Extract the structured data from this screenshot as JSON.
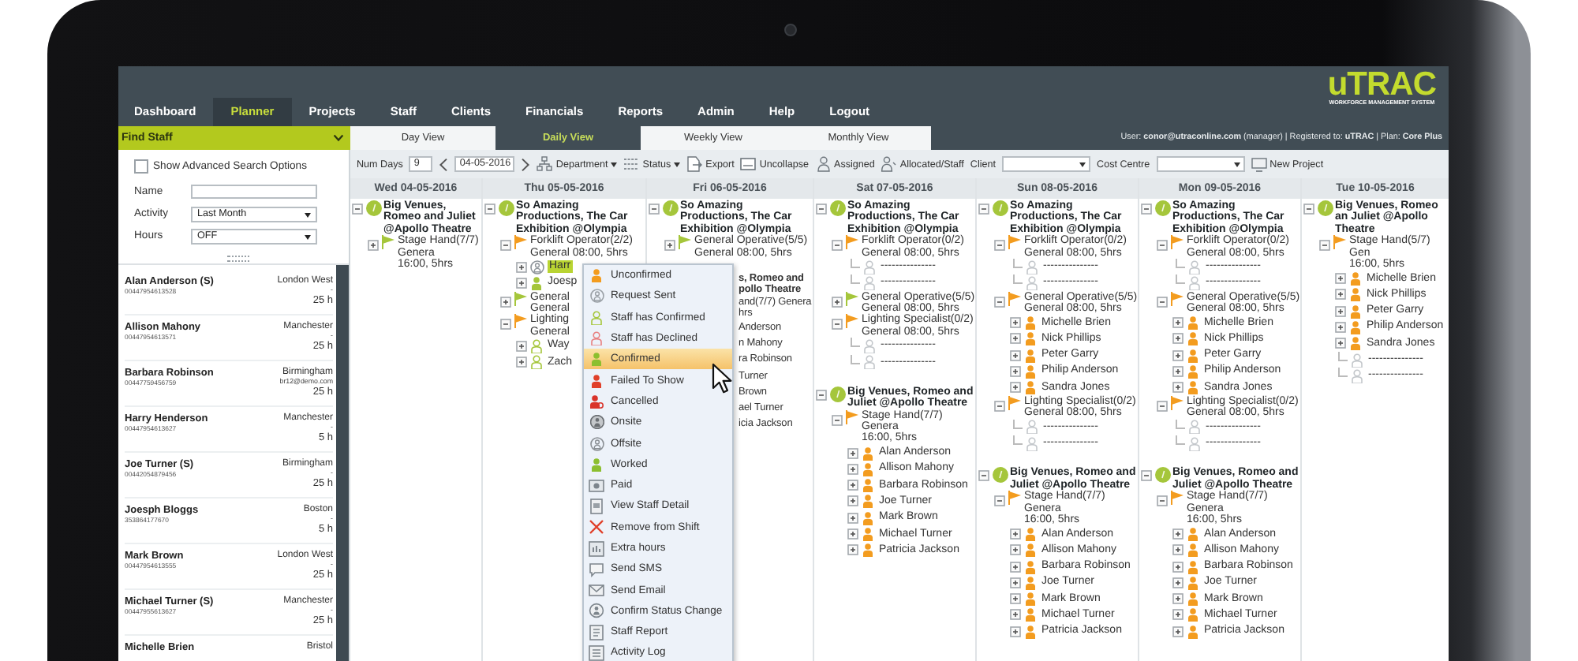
{
  "nav": {
    "logo": "uTRAC",
    "logo_subtitle": "WORKFORCE MANAGEMENT SYSTEM",
    "items": [
      {
        "label": "Dashboard",
        "selected": false
      },
      {
        "label": "Planner",
        "selected": true
      },
      {
        "label": "Projects",
        "selected": false
      },
      {
        "label": "Staff",
        "selected": false
      },
      {
        "label": "Clients",
        "selected": false
      },
      {
        "label": "Financials",
        "selected": false
      },
      {
        "label": "Reports",
        "selected": false
      },
      {
        "label": "Admin",
        "selected": false
      },
      {
        "label": "Help",
        "selected": false
      },
      {
        "label": "Logout",
        "selected": false
      }
    ],
    "user_info": "User: **conor@utraconline.com** (manager) | Registered to: **uTRAC** | Plan: **Core Plus**"
  },
  "find_staff": {
    "title": "Find Staff",
    "advanced": {
      "label": "Show Advanced Search Options",
      "checked": false
    },
    "fields": [
      {
        "label": "Name",
        "kind": "text"
      },
      {
        "label": "Activity",
        "kind": "select",
        "value": "Last Month"
      },
      {
        "label": "Hours",
        "kind": "select",
        "value": "OFF"
      }
    ]
  },
  "staff_list": [
    {
      "name": "Alan Anderson (S)",
      "phone": "00447954613528",
      "location": "London West",
      "email": "-",
      "hours": "25 h"
    },
    {
      "name": "Allison Mahony",
      "phone": "00447954613571",
      "location": "Manchester",
      "email": "-",
      "hours": "25 h"
    },
    {
      "name": "Barbara Robinson",
      "phone": "00447759456759",
      "location": "Birmingham",
      "email": "br12@demo.com",
      "hours": "25 h"
    },
    {
      "name": "Harry Henderson",
      "phone": "00447954613627",
      "location": "Manchester",
      "email": "-",
      "hours": "5 h"
    },
    {
      "name": "Joe Turner (S)",
      "phone": "00442054879456",
      "location": "Birmingham",
      "email": "-",
      "hours": "25 h"
    },
    {
      "name": "Joesph Bloggs",
      "phone": "353864177670",
      "location": "Boston",
      "email": "-",
      "hours": "5 h"
    },
    {
      "name": "Mark Brown",
      "phone": "00447954613555",
      "location": "London West",
      "email": "-",
      "hours": "25 h"
    },
    {
      "name": "Michael Turner (S)",
      "phone": "00447955613627",
      "location": "Manchester",
      "email": "-",
      "hours": "25 h"
    },
    {
      "name": "Michelle Brien",
      "location": "Bristol"
    }
  ],
  "view_tabs": [
    {
      "label": "Day View",
      "selected": false
    },
    {
      "label": "Daily View",
      "selected": true
    },
    {
      "label": "Weekly View",
      "selected": false
    },
    {
      "label": "Monthly View",
      "selected": false
    }
  ],
  "toolbar": {
    "num_days_label": "Num Days",
    "num_days": "9",
    "date": "04-05-2016",
    "actions": [
      {
        "label": "Department",
        "kind": "dropdown"
      },
      {
        "label": "Status",
        "kind": "dropdown"
      },
      {
        "label": "Export",
        "kind": "button"
      },
      {
        "label": "Uncollapse",
        "kind": "button"
      },
      {
        "label": "Assigned",
        "kind": "button"
      },
      {
        "label": "Allocated/Staff",
        "kind": "button"
      }
    ],
    "filters": [
      {
        "label": "Client"
      },
      {
        "label": "Cost Centre"
      }
    ],
    "new_project": "New Project"
  },
  "days": [
    {
      "label": "Wed 04-05-2016",
      "projects": [
        {
          "title": "Big Venues, Romeo and Juliet @Apollo Theatre",
          "expanded": true,
          "roles": [
            {
              "title": "Stage Hand(7/7) Genera",
              "time": "16:00, 5hrs",
              "color": "#a5c63b",
              "expanded": false
            }
          ]
        }
      ]
    },
    {
      "label": "Thu 05-05-2016",
      "projects": [
        {
          "title": "So Amazing Productions, The Car Exhibition @Olympia",
          "expanded": true,
          "roles": [
            {
              "title": "Forklift Operator(2/2)",
              "time": "General 08:00, 5hrs",
              "color": "#f39c1f",
              "expanded": true,
              "staff": [
                {
                  "name": "Harr",
                  "kind": "requested",
                  "selected": true
                },
                {
                  "name": "Joesp",
                  "kind": "confirmed",
                  "selected": false
                }
              ]
            },
            {
              "title": "General",
              "time": "General",
              "color": "#a5c63b",
              "expanded": false
            },
            {
              "title": "Lighting",
              "time": "General",
              "color": "#f39c1f",
              "expanded": true,
              "staff": [
                {
                  "name": "Way",
                  "kind": "accepted",
                  "selected": false
                },
                {
                  "name": "Zach",
                  "kind": "accepted",
                  "selected": false
                }
              ]
            }
          ]
        }
      ]
    },
    {
      "label": "Fri 06-05-2016",
      "projects": [
        {
          "title": "So Amazing Productions, The Car Exhibition @Olympia",
          "expanded": true,
          "roles": [
            {
              "title": "General Operative(5/5)",
              "time": "General 08:00, 5hrs",
              "color": "#a5c63b",
              "expanded": false
            }
          ]
        }
      ],
      "covered": [
        {
          "text": "s, Romeo and",
          "kind": "project"
        },
        {
          "text": "pollo Theatre",
          "kind": "project"
        },
        {
          "text": "and(7/7) Genera",
          "kind": "role"
        },
        {
          "text": "hrs",
          "kind": "role"
        },
        {
          "text": "Anderson",
          "kind": "staff"
        },
        {
          "text": "n Mahony",
          "kind": "staff"
        },
        {
          "text": "ra Robinson",
          "kind": "staff"
        },
        {
          "text": "Turner",
          "kind": "staff"
        },
        {
          "text": "Brown",
          "kind": "staff"
        },
        {
          "text": "ael Turner",
          "kind": "staff"
        },
        {
          "text": "icia Jackson",
          "kind": "staff"
        }
      ]
    },
    {
      "label": "Sat 07-05-2016",
      "projects": [
        {
          "title": "So Amazing Productions, The Car Exhibition @Olympia",
          "expanded": true,
          "roles": [
            {
              "title": "Forklift Operator(0/2)",
              "time": "General 08:00, 5hrs",
              "color": "#f39c1f",
              "expanded": true,
              "staff": [
                {
                  "name": "---------------",
                  "kind": "vacant",
                  "selected": false
                },
                {
                  "name": "---------------",
                  "kind": "vacant",
                  "selected": false
                }
              ]
            },
            {
              "title": "General Operative(5/5)",
              "time": "General 08:00, 5hrs",
              "color": "#a5c63b",
              "expanded": false
            },
            {
              "title": "Lighting Specialist(0/2)",
              "time": "General 08:00, 5hrs",
              "color": "#f39c1f",
              "expanded": true,
              "staff": [
                {
                  "name": "---------------",
                  "kind": "vacant",
                  "selected": false
                },
                {
                  "name": "---------------",
                  "kind": "vacant",
                  "selected": false
                }
              ]
            }
          ]
        },
        {
          "title": "Big Venues, Romeo and Juliet @Apollo Theatre",
          "expanded": true,
          "roles": [
            {
              "title": "Stage Hand(7/7) Genera",
              "time": "16:00, 5hrs",
              "color": "#f39c1f",
              "expanded": true,
              "staff": [
                {
                  "name": "Alan Anderson",
                  "kind": "unconfirmed",
                  "selected": false
                },
                {
                  "name": "Allison Mahony",
                  "kind": "unconfirmed",
                  "selected": false
                },
                {
                  "name": "Barbara Robinson",
                  "kind": "unconfirmed",
                  "selected": false
                },
                {
                  "name": "Joe Turner",
                  "kind": "unconfirmed",
                  "selected": false
                },
                {
                  "name": "Mark Brown",
                  "kind": "unconfirmed",
                  "selected": false
                },
                {
                  "name": "Michael Turner",
                  "kind": "unconfirmed",
                  "selected": false
                },
                {
                  "name": "Patricia Jackson",
                  "kind": "unconfirmed",
                  "selected": false
                }
              ]
            }
          ]
        }
      ]
    },
    {
      "label": "Sun 08-05-2016",
      "projects": [
        {
          "title": "So Amazing Productions, The Car Exhibition @Olympia",
          "expanded": true,
          "roles": [
            {
              "title": "Forklift Operator(0/2)",
              "time": "General 08:00, 5hrs",
              "color": "#f39c1f",
              "expanded": true,
              "staff": [
                {
                  "name": "---------------",
                  "kind": "vacant",
                  "selected": false
                },
                {
                  "name": "---------------",
                  "kind": "vacant",
                  "selected": false
                }
              ]
            },
            {
              "title": "General Operative(5/5)",
              "time": "General 08:00, 5hrs",
              "color": "#f39c1f",
              "expanded": true,
              "staff": [
                {
                  "name": "Michelle Brien",
                  "kind": "unconfirmed",
                  "selected": false
                },
                {
                  "name": "Nick Phillips",
                  "kind": "unconfirmed",
                  "selected": false
                },
                {
                  "name": "Peter Garry",
                  "kind": "unconfirmed",
                  "selected": false
                },
                {
                  "name": "Philip Anderson",
                  "kind": "unconfirmed",
                  "selected": false
                },
                {
                  "name": "Sandra Jones",
                  "kind": "unconfirmed",
                  "selected": false
                }
              ]
            },
            {
              "title": "Lighting Specialist(0/2)",
              "time": "General 08:00, 5hrs",
              "color": "#f39c1f",
              "expanded": true,
              "staff": [
                {
                  "name": "---------------",
                  "kind": "vacant",
                  "selected": false
                },
                {
                  "name": "---------------",
                  "kind": "vacant",
                  "selected": false
                }
              ]
            }
          ]
        },
        {
          "title": "Big Venues, Romeo and Juliet @Apollo Theatre",
          "expanded": true,
          "roles": [
            {
              "title": "Stage Hand(7/7) Genera",
              "time": "16:00, 5hrs",
              "color": "#f39c1f",
              "expanded": true,
              "staff": [
                {
                  "name": "Alan Anderson",
                  "kind": "unconfirmed",
                  "selected": false
                },
                {
                  "name": "Allison Mahony",
                  "kind": "unconfirmed",
                  "selected": false
                },
                {
                  "name": "Barbara Robinson",
                  "kind": "unconfirmed",
                  "selected": false
                },
                {
                  "name": "Joe Turner",
                  "kind": "unconfirmed",
                  "selected": false
                },
                {
                  "name": "Mark Brown",
                  "kind": "unconfirmed",
                  "selected": false
                },
                {
                  "name": "Michael Turner",
                  "kind": "unconfirmed",
                  "selected": false
                },
                {
                  "name": "Patricia Jackson",
                  "kind": "unconfirmed",
                  "selected": false
                }
              ]
            }
          ]
        }
      ]
    },
    {
      "label": "Mon 09-05-2016",
      "projects": [
        {
          "title": "So Amazing Productions, The Car Exhibition @Olympia",
          "expanded": true,
          "roles": [
            {
              "title": "Forklift Operator(0/2)",
              "time": "General 08:00, 5hrs",
              "color": "#f39c1f",
              "expanded": true,
              "staff": [
                {
                  "name": "---------------",
                  "kind": "vacant",
                  "selected": false
                },
                {
                  "name": "---------------",
                  "kind": "vacant",
                  "selected": false
                }
              ]
            },
            {
              "title": "General Operative(5/5)",
              "time": "General 08:00, 5hrs",
              "color": "#f39c1f",
              "expanded": true,
              "staff": [
                {
                  "name": "Michelle Brien",
                  "kind": "unconfirmed",
                  "selected": false
                },
                {
                  "name": "Nick Phillips",
                  "kind": "unconfirmed",
                  "selected": false
                },
                {
                  "name": "Peter Garry",
                  "kind": "unconfirmed",
                  "selected": false
                },
                {
                  "name": "Philip Anderson",
                  "kind": "unconfirmed",
                  "selected": false
                },
                {
                  "name": "Sandra Jones",
                  "kind": "unconfirmed",
                  "selected": false
                }
              ]
            },
            {
              "title": "Lighting Specialist(0/2)",
              "time": "General 08:00, 5hrs",
              "color": "#f39c1f",
              "expanded": true,
              "staff": [
                {
                  "name": "---------------",
                  "kind": "vacant",
                  "selected": false
                },
                {
                  "name": "---------------",
                  "kind": "vacant",
                  "selected": false
                }
              ]
            }
          ]
        },
        {
          "title": "Big Venues, Romeo and Juliet @Apollo Theatre",
          "expanded": true,
          "roles": [
            {
              "title": "Stage Hand(7/7) Genera",
              "time": "16:00, 5hrs",
              "color": "#f39c1f",
              "expanded": true,
              "staff": [
                {
                  "name": "Alan Anderson",
                  "kind": "unconfirmed",
                  "selected": false
                },
                {
                  "name": "Allison Mahony",
                  "kind": "unconfirmed",
                  "selected": false
                },
                {
                  "name": "Barbara Robinson",
                  "kind": "unconfirmed",
                  "selected": false
                },
                {
                  "name": "Joe Turner",
                  "kind": "unconfirmed",
                  "selected": false
                },
                {
                  "name": "Mark Brown",
                  "kind": "unconfirmed",
                  "selected": false
                },
                {
                  "name": "Michael Turner",
                  "kind": "unconfirmed",
                  "selected": false
                },
                {
                  "name": "Patricia Jackson",
                  "kind": "unconfirmed",
                  "selected": false
                }
              ]
            }
          ]
        }
      ]
    },
    {
      "label": "Tue 10-05-2016",
      "projects": [
        {
          "title": "Big Venues, Romeo an Juliet @Apollo Theatre",
          "expanded": true,
          "roles": [
            {
              "title": "Stage Hand(5/7) Gen",
              "time": "16:00, 5hrs",
              "color": "#f39c1f",
              "expanded": true,
              "staff": [
                {
                  "name": "Michelle Brien",
                  "kind": "unconfirmed",
                  "selected": false
                },
                {
                  "name": "Nick Phillips",
                  "kind": "unconfirmed",
                  "selected": false
                },
                {
                  "name": "Peter Garry",
                  "kind": "unconfirmed",
                  "selected": false
                },
                {
                  "name": "Philip Anderson",
                  "kind": "unconfirmed",
                  "selected": false
                },
                {
                  "name": "Sandra Jones",
                  "kind": "unconfirmed",
                  "selected": false
                },
                {
                  "name": "---------------",
                  "kind": "vacant",
                  "selected": false
                },
                {
                  "name": "---------------",
                  "kind": "vacant",
                  "selected": false
                }
              ]
            }
          ]
        }
      ]
    }
  ],
  "context_menu": {
    "items": [
      {
        "label": "Unconfirmed",
        "kind": "solid",
        "color": "#f39c1f",
        "selected": false
      },
      {
        "label": "Request Sent",
        "kind": "circle",
        "color": "#9aa0a6",
        "selected": false
      },
      {
        "label": "Staff has Confirmed",
        "kind": "outline",
        "color": "#a5c63b",
        "selected": false
      },
      {
        "label": "Staff has Declined",
        "kind": "outline",
        "color": "#e88080",
        "selected": false
      },
      {
        "label": "Confirmed",
        "kind": "solid",
        "color": "#8cbf2f",
        "selected": true
      },
      {
        "label": "Failed To Show",
        "kind": "solid",
        "color": "#e0402a",
        "selected": false
      },
      {
        "label": "Cancelled",
        "kind": "cancelled",
        "color": "#d9332a",
        "selected": false
      },
      {
        "label": "Onsite",
        "kind": "badge",
        "color": "#6b6f73",
        "selected": false
      },
      {
        "label": "Offsite",
        "kind": "circle",
        "color": "#8a8f94",
        "selected": false
      },
      {
        "label": "Worked",
        "kind": "solid",
        "color": "#8cbf2f",
        "selected": false
      },
      {
        "label": "Paid",
        "kind": "paid",
        "selected": false
      },
      {
        "label": "View Staff Detail",
        "kind": "detail",
        "selected": false
      },
      {
        "label": "Remove from Shift",
        "kind": "remove",
        "selected": false
      },
      {
        "label": "Extra hours",
        "kind": "hours",
        "selected": false
      },
      {
        "label": "Send SMS",
        "kind": "sms",
        "selected": false
      },
      {
        "label": "Send Email",
        "kind": "email",
        "selected": false
      },
      {
        "label": "Confirm Status Change",
        "kind": "confirm",
        "selected": false
      },
      {
        "label": "Staff Report",
        "kind": "report",
        "selected": false
      },
      {
        "label": "Activity Log",
        "kind": "log",
        "selected": false
      }
    ]
  }
}
